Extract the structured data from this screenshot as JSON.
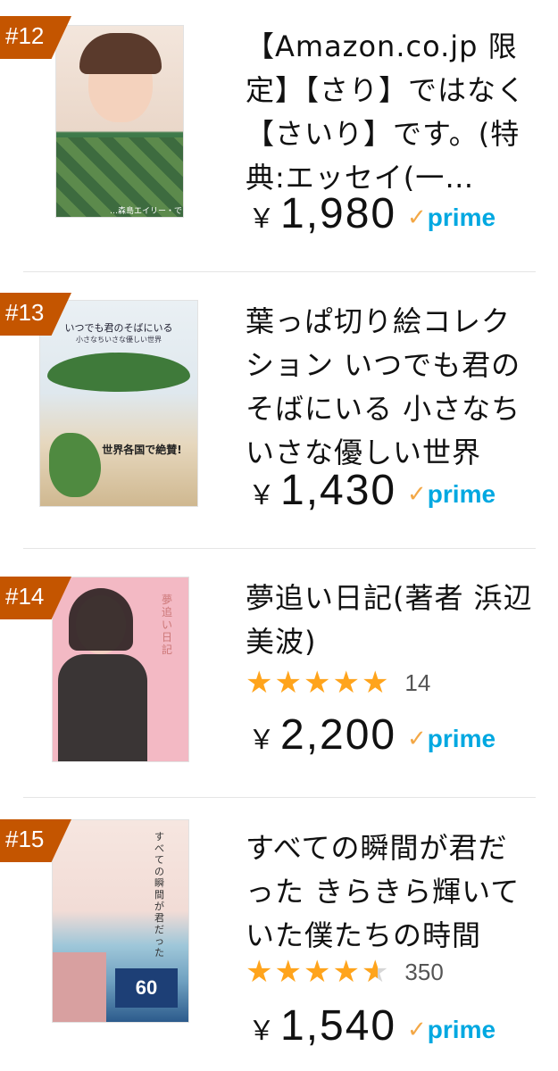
{
  "items": [
    {
      "rank": "#12",
      "title": "【Amazon.co.jp 限定】【さり】ではなく【さいり】です。(特典:エッセイ(一…",
      "currency": "￥",
      "price": "1,980",
      "prime": "prime",
      "cover_caption": "…森島エイリー・です。"
    },
    {
      "rank": "#13",
      "title": "葉っぱ切り絵コレクション いつでも君のそばにいる 小さなちいさな優しい世界",
      "currency": "￥",
      "price": "1,430",
      "prime": "prime",
      "cover_title": "いつでも君のそばにいる",
      "cover_subtitle": "小さなちいさな優しい世界",
      "cover_banner": "世界各国で絶賛!"
    },
    {
      "rank": "#14",
      "title": "夢追い日記(著者 浜辺美波)",
      "rating": 5,
      "reviews": "14",
      "currency": "￥",
      "price": "2,200",
      "prime": "prime",
      "cover_title": "夢追い日記"
    },
    {
      "rank": "#15",
      "title": "すべての瞬間が君だった きらきら輝いていた僕たちの時間",
      "rating": 4.5,
      "reviews": "350",
      "currency": "￥",
      "price": "1,540",
      "prime": "prime",
      "cover_title": "すべての瞬間が君だった",
      "cover_badge": "60"
    }
  ],
  "colors": {
    "badge": "#c45500",
    "star": "#ffa41c",
    "prime_text": "#00a8e1",
    "prime_check": "#f3a847"
  }
}
